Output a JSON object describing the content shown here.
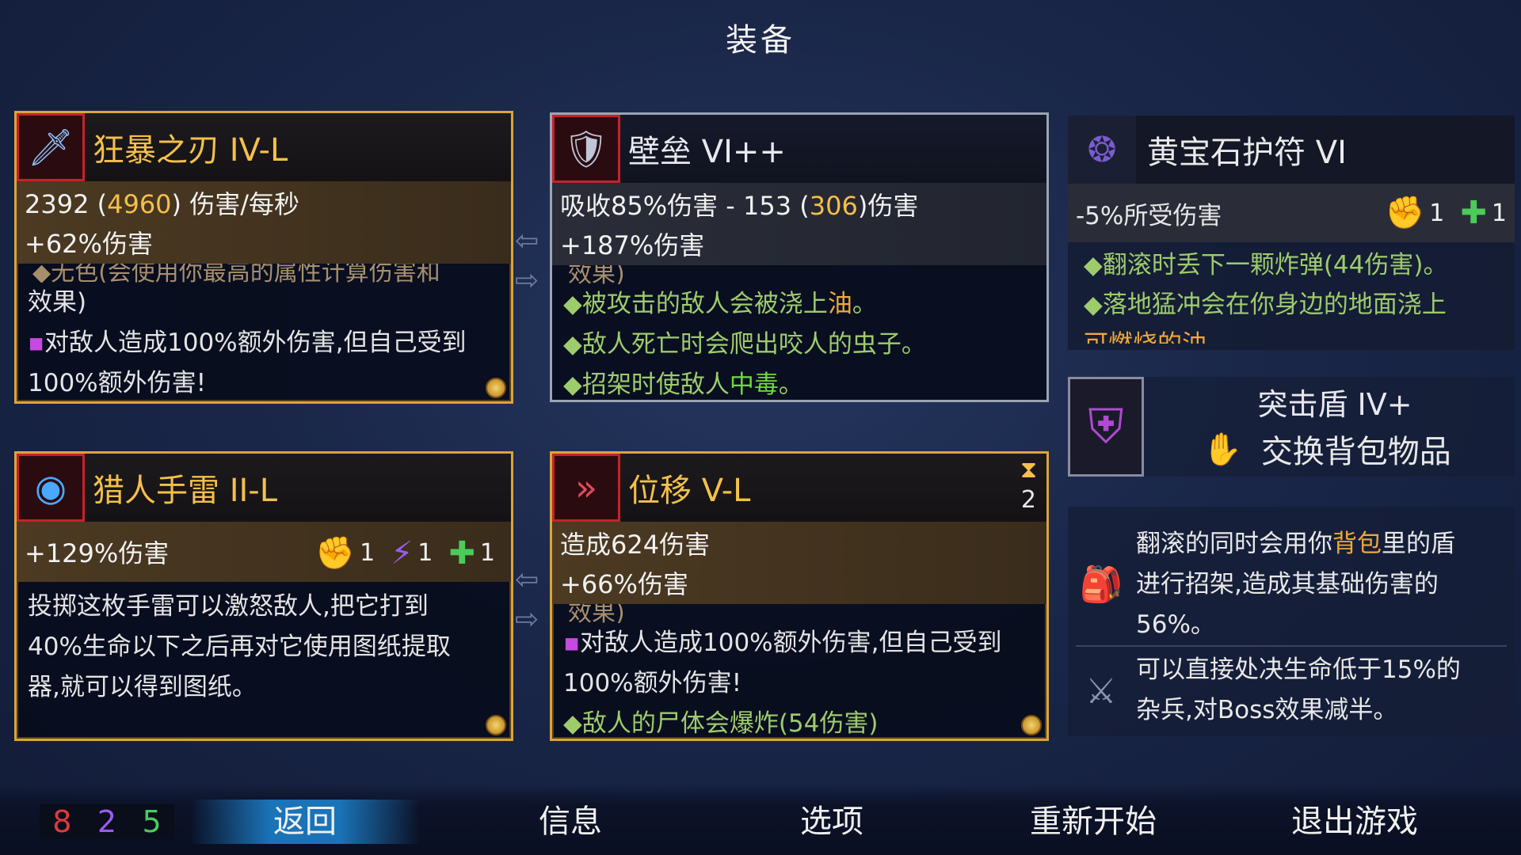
{
  "title": "装备",
  "weapons": [
    {
      "name": "狂暴之刃 IV-L",
      "icon": "blade-icon",
      "stats_line1_pre": "2392 (",
      "stats_line1_hl": "4960",
      "stats_line1_post": ") 伤害/每秒",
      "stats_line2": "+62%伤害",
      "cut_text": "◆无色(会使用你最高的属性计算伤害和",
      "desc_line1": "效果)",
      "desc_line2": "对敌人造成100%额外伤害,但自己受到",
      "desc_line3": "100%额外伤害!"
    },
    {
      "name": "壁垒 VI++",
      "icon": "shield-icon",
      "stats_line1_pre": "吸收85%伤害 - 153 (",
      "stats_line1_hl": "306",
      "stats_line1_post": ")伤害",
      "stats_line2": "+187%伤害",
      "cut_text": "效果)",
      "desc_line1_pre": "◆被攻击的敌人会被浇上",
      "desc_line1_hl": "油",
      "desc_line1_post": "。",
      "desc_line2": "◆敌人死亡时会爬出咬人的虫子。",
      "desc_line3_pre": "◆招架时使敌人",
      "desc_line3_hl": "中毒",
      "desc_line3_post": "。"
    }
  ],
  "skills": [
    {
      "name": "猎人手雷 II-L",
      "icon": "grenade-icon",
      "stats_line1": "+129%伤害",
      "scrolls": [
        {
          "icon": "brutality-scroll-icon",
          "count": "1"
        },
        {
          "icon": "tactics-scroll-icon",
          "count": "1"
        },
        {
          "icon": "survival-scroll-icon",
          "count": "1"
        }
      ],
      "desc_line1": "投掷这枚手雷可以激怒敌人,把它打到",
      "desc_line2": "40%生命以下之后再对它使用图纸提取",
      "desc_line3": "器,就可以得到图纸。"
    },
    {
      "name": "位移 V-L",
      "icon": "dash-icon",
      "charges": "2",
      "stats_line1": "造成624伤害",
      "stats_line2": "+66%伤害",
      "cut_text": "效果)",
      "desc_line1": "对敌人造成100%额外伤害,但自己受到",
      "desc_line2": "100%额外伤害!",
      "desc_line3": "◆敌人的尸体会爆炸(54伤害)"
    }
  ],
  "amulet": {
    "name": "黄宝石护符 VI",
    "icon": "amulet-icon",
    "stat": "-5%所受伤害",
    "scrolls": [
      {
        "icon": "brutality-scroll-icon",
        "count": "1"
      },
      {
        "icon": "survival-scroll-icon",
        "count": "1"
      }
    ],
    "line1": "◆翻滚时丢下一颗炸弹(44伤害)。",
    "line2": "◆落地猛冲会在你身边的地面浇上",
    "line3": "可燃烧的油"
  },
  "backpack": {
    "name": "突击盾 IV+",
    "swap_label": "交换背包物品"
  },
  "mutations": [
    {
      "icon": "backpack-parry-icon",
      "line1_pre": "翻滚的同时会用你",
      "line1_hl": "背包",
      "line1_post": "里的盾",
      "line2": "进行招架,造成其基础伤害的",
      "line3": "56%。"
    },
    {
      "icon": "execute-icon",
      "line1": "可以直接处决生命低于15%的",
      "line2": "杂兵,对Boss效果减半。"
    }
  ],
  "counters": {
    "red": "8",
    "purple": "2",
    "green": "5"
  },
  "menu": {
    "back": "返回",
    "info": "信息",
    "options": "选项",
    "restart": "重新开始",
    "quit": "退出游戏"
  },
  "colors": {
    "gold": "#d9a53a",
    "highlight": "#f4c04a",
    "green": "#9ecb6c",
    "orange": "#f0a83a",
    "red": "#e03a3a",
    "purple": "#9a5cf0",
    "counter_green": "#4ccb5a"
  }
}
